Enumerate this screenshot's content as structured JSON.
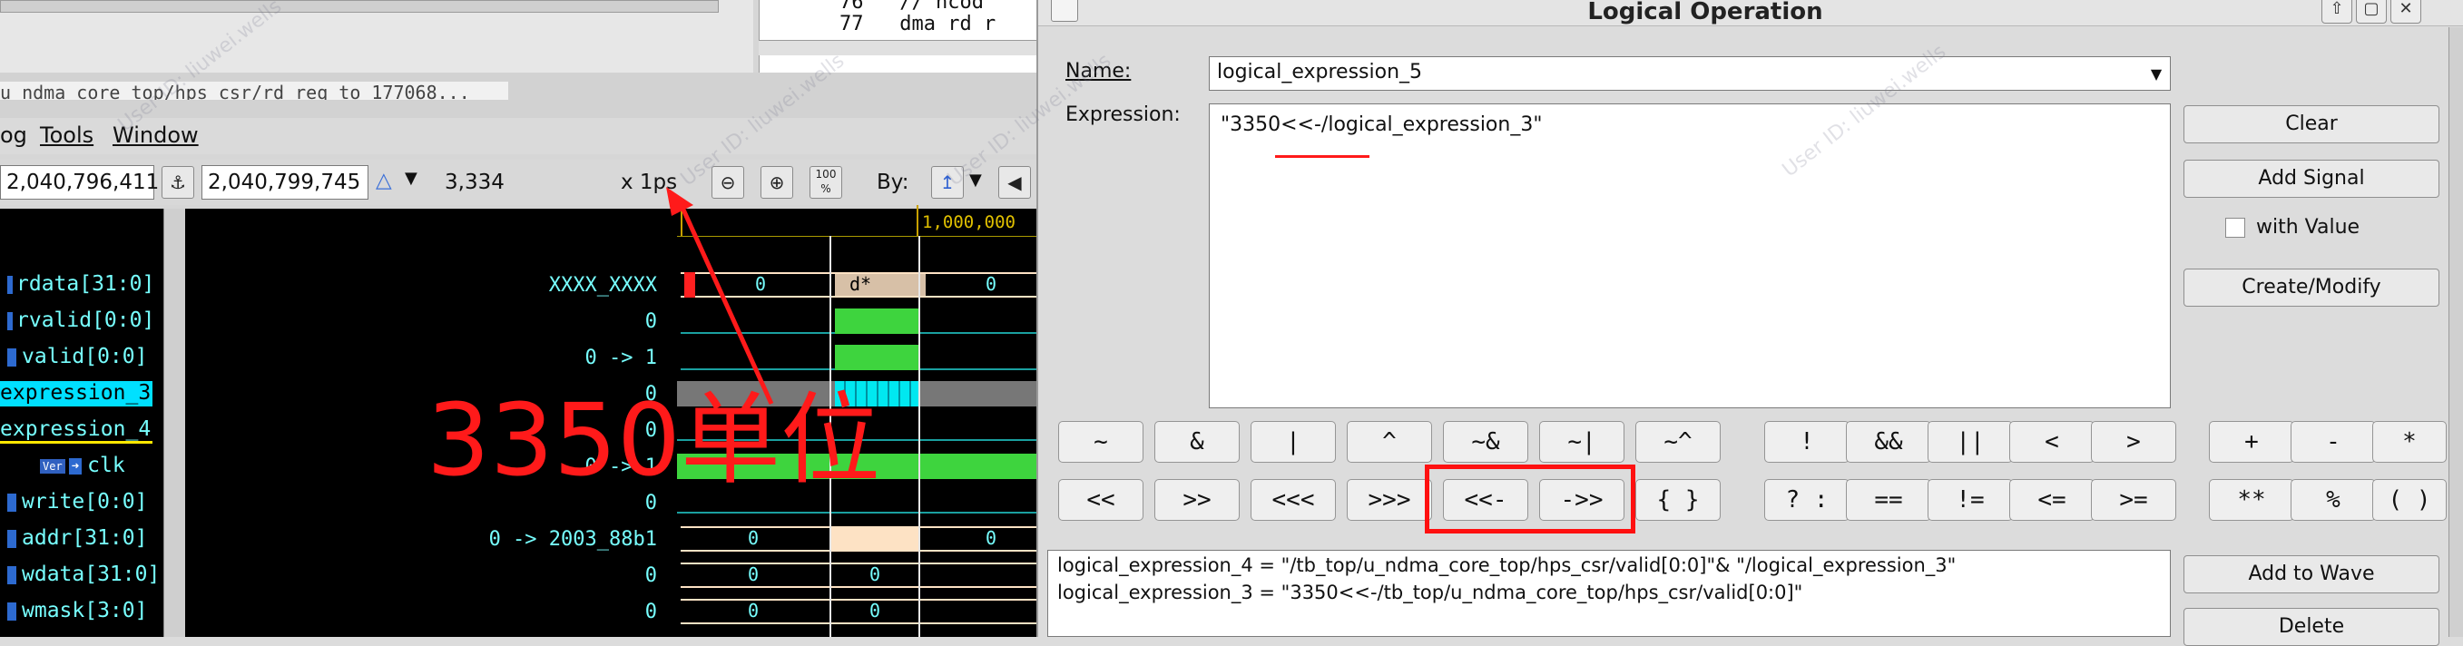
{
  "viewer": {
    "source_lines": [
      {
        "num": "76",
        "code": "// ncod"
      },
      {
        "num": "77",
        "code": "dma rd r"
      }
    ],
    "path_text": "u_ndma_core_top/hps_csr/rd_req_to_177068...",
    "menu": [
      "og",
      "Tools",
      "Window"
    ],
    "toolbar": {
      "cursor1": "2,040,796,411",
      "cursor2": "2,040,799,745",
      "delta": "3,334",
      "unit": "x 1ps",
      "by_label": "By:"
    },
    "time_marker": "1,000,000",
    "signals": [
      {
        "name": "rdata[31:0]",
        "value": "XXXX_XXXX"
      },
      {
        "name": "rvalid[0:0]",
        "value": "0"
      },
      {
        "name": "valid[0:0]",
        "value": "0 -> 1"
      },
      {
        "name": "expression_3",
        "value": "0"
      },
      {
        "name": "expression_4",
        "value": "0"
      },
      {
        "name": "clk",
        "value": "0 -> 1"
      },
      {
        "name": "write[0:0]",
        "value": "0"
      },
      {
        "name": "addr[31:0]",
        "value": "0 -> 2003_88b1"
      },
      {
        "name": "wdata[31:0]",
        "value": "0"
      },
      {
        "name": "wmask[3:0]",
        "value": "0"
      }
    ],
    "wave_labels": {
      "rdata_a": "0",
      "rdata_b": "d*",
      "rdata_c": "0",
      "addr_a": "0",
      "addr_b": "0",
      "wdata_a": "0",
      "wdata_b": "0",
      "wmask_a": "0",
      "wmask_b": "0"
    },
    "annotation": "3350单位",
    "watermark": "User ID: liuwei.wells"
  },
  "dialog": {
    "title": "Logical Operation",
    "name_label": "Name:",
    "name_value": "logical_expression_5",
    "expression_label": "Expression:",
    "expression_value": "\"3350<<-/logical_expression_3\"",
    "buttons": {
      "clear": "Clear",
      "add_signal": "Add Signal",
      "with_value": "with Value",
      "create_modify": "Create/Modify",
      "add_to_wave": "Add to Wave",
      "delete": "Delete"
    },
    "operators_row1": [
      "~",
      "&",
      "|",
      "^",
      "~&",
      "~|",
      "~^",
      "!",
      "&&",
      "||",
      "<",
      ">",
      "+",
      "-",
      "*"
    ],
    "operators_row2": [
      "<<",
      ">>",
      "<<<",
      ">>>",
      "<<-",
      "->>",
      "{ }",
      "? :",
      "==",
      "!=",
      "<=",
      ">=",
      "**",
      "%",
      "( )"
    ],
    "expressions_list": [
      "logical_expression_4 = \"/tb_top/u_ndma_core_top/hps_csr/valid[0:0]\"& \"/logical_expression_3\"",
      "logical_expression_3 = \"3350<<-/tb_top/u_ndma_core_top/hps_csr/valid[0:0]\""
    ]
  },
  "colors": {
    "annotation_red": "#ff1a1a",
    "signal_cyan": "#77ffff",
    "pulse_green": "#3ed43e",
    "highlight_cyan": "#00e0ff"
  }
}
